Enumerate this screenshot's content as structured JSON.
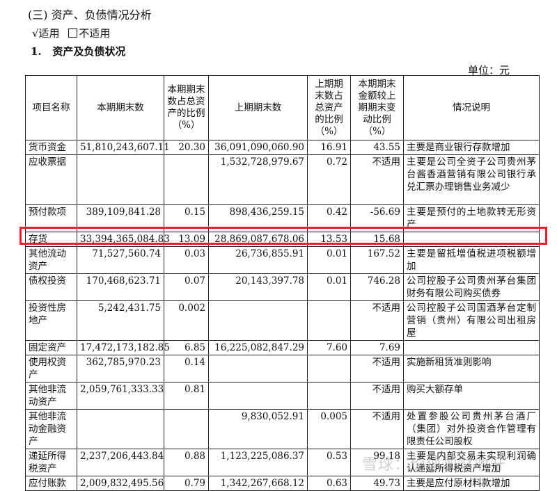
{
  "section": {
    "title": "(三) 资产、负债情况分析",
    "applicable": "√适用",
    "not_applicable": "不适用",
    "subtitle_num": "1.",
    "subtitle": "资产及负债状况",
    "unit": "单位：元"
  },
  "table": {
    "headers": [
      "项目名称",
      "本期期末数",
      "本期期末数占总资产的比例（%）",
      "上期期末数",
      "上期期末数占总资产的比例（%）",
      "本期期末金额较上期期末变动比例（%）",
      "情况说明"
    ],
    "rows": [
      {
        "name": "货币资金",
        "cur": "51,810,243,607.11",
        "cur_pct": "20.30",
        "prev": "36,091,090,060.90",
        "prev_pct": "16.91",
        "chg": "43.55",
        "note": "主要是商业银行存款增加"
      },
      {
        "name": "应收票据",
        "cur": "",
        "cur_pct": "",
        "prev": "1,532,728,979.67",
        "prev_pct": "0.72",
        "chg": "不适用",
        "note": "主要是公司全资子公司贵州茅台酱香酒营销有限公司银行承兑汇票办理销售业务减少"
      },
      {
        "name": "预付款项",
        "cur": "389,109,841.28",
        "cur_pct": "0.15",
        "prev": "898,436,259.15",
        "prev_pct": "0.42",
        "chg": "-56.69",
        "note": "主要是预付的土地款转无形资产"
      },
      {
        "name": "存货",
        "cur": "33,394,365,084.83",
        "cur_pct": "13.09",
        "prev": "28,869,087,678.06",
        "prev_pct": "13.53",
        "chg": "15.68",
        "note": ""
      },
      {
        "name": "其他流动资产",
        "cur": "71,527,560.74",
        "cur_pct": "0.03",
        "prev": "26,736,855.91",
        "prev_pct": "0.01",
        "chg": "167.52",
        "note": "主要是留抵增值税进项税额增加"
      },
      {
        "name": "债权投资",
        "cur": "170,468,623.71",
        "cur_pct": "0.07",
        "prev": "20,143,397.78",
        "prev_pct": "0.01",
        "chg": "746.28",
        "note": "公司控股子公司贵州茅台集团财务有限公司购买债券"
      },
      {
        "name": "投资性房地产",
        "cur": "5,242,431.75",
        "cur_pct": "0.002",
        "prev": "",
        "prev_pct": "",
        "chg": "不适用",
        "note": "公司控股子公司国酒茅台定制营销（贵州）有限公司出租房屋"
      },
      {
        "name": "固定资产",
        "cur": "17,472,173,182.85",
        "cur_pct": "6.85",
        "prev": "16,225,082,847.29",
        "prev_pct": "7.60",
        "chg": "7.69",
        "note": ""
      },
      {
        "name": "使用权资产",
        "cur": "362,785,970.23",
        "cur_pct": "0.14",
        "prev": "",
        "prev_pct": "",
        "chg": "不适用",
        "note": "实施新租赁准则影响"
      },
      {
        "name": "其他非流动资产",
        "cur": "2,059,761,333.33",
        "cur_pct": "0.81",
        "prev": "",
        "prev_pct": "",
        "chg": "不适用",
        "note": "购买大额存单"
      },
      {
        "name": "其他非流动金融资产",
        "cur": "",
        "cur_pct": "",
        "prev": "9,830,052.91",
        "prev_pct": "0.005",
        "chg": "不适用",
        "note": "处置参股公司贵州茅台酒厂（集团）对外投资合作管理有限责任公司股权"
      },
      {
        "name": "递延所得税资产",
        "cur": "2,237,206,443.84",
        "cur_pct": "0.88",
        "prev": "1,123,225,086.37",
        "prev_pct": "0.53",
        "chg": "99.18",
        "note": "主要是内部交易未实现利润确认递延所得税资产增加"
      },
      {
        "name": "应付账款",
        "cur": "2,009,832,495.56",
        "cur_pct": "0.79",
        "prev": "1,342,267,668.12",
        "prev_pct": "0.63",
        "chg": "49.73",
        "note": "主要是应付原材料款增加"
      }
    ]
  },
  "watermark": "雪球：价值加财收开"
}
